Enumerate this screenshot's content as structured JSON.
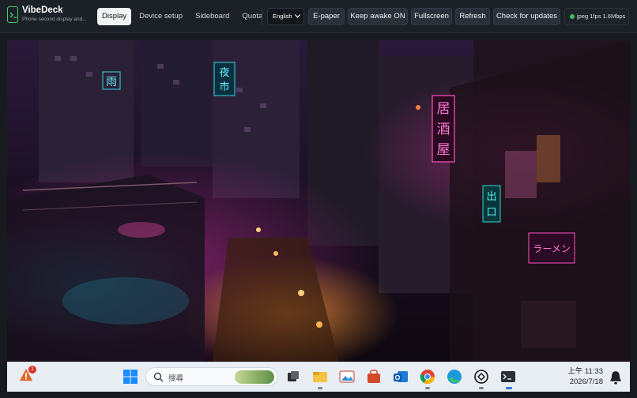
{
  "app": {
    "title": "VibeDeck",
    "subtitle": "Phone second display and..."
  },
  "tabs": [
    {
      "label": "Display",
      "active": true
    },
    {
      "label": "Device setup",
      "active": false
    },
    {
      "label": "Sideboard",
      "active": false
    },
    {
      "label": "Quota",
      "active": false
    }
  ],
  "language": {
    "selected": "English"
  },
  "buttons": {
    "epaper": "E-paper",
    "keep_awake": "Keep awake ON",
    "fullscreen": "Fullscreen",
    "refresh": "Refresh",
    "check_updates": "Check for updates"
  },
  "status": {
    "text": "jpeg 1fps 1.6Mbps",
    "color": "#36c25b"
  },
  "wallpaper": {
    "signs": {
      "rain": "雨",
      "night_market": "夜市",
      "izakaya": "居酒屋",
      "exit": "出口",
      "ramen": "ラーメン"
    }
  },
  "taskbar": {
    "search_placeholder": "搜尋",
    "notification_count": "1",
    "clock_time": "上午 11:33",
    "clock_date": "2026/7/18",
    "icons": [
      "start-icon",
      "search-icon",
      "widgets-icon",
      "file-explorer-icon",
      "photos-icon",
      "store-icon",
      "outlook-icon",
      "chrome-icon",
      "edge-icon",
      "chatgpt-icon",
      "terminal-icon",
      "notification-bell-icon"
    ]
  },
  "colors": {
    "accent_green": "#3ecf6e",
    "neon_pink": "#ff3fb0",
    "neon_cyan": "#23d6e6"
  }
}
